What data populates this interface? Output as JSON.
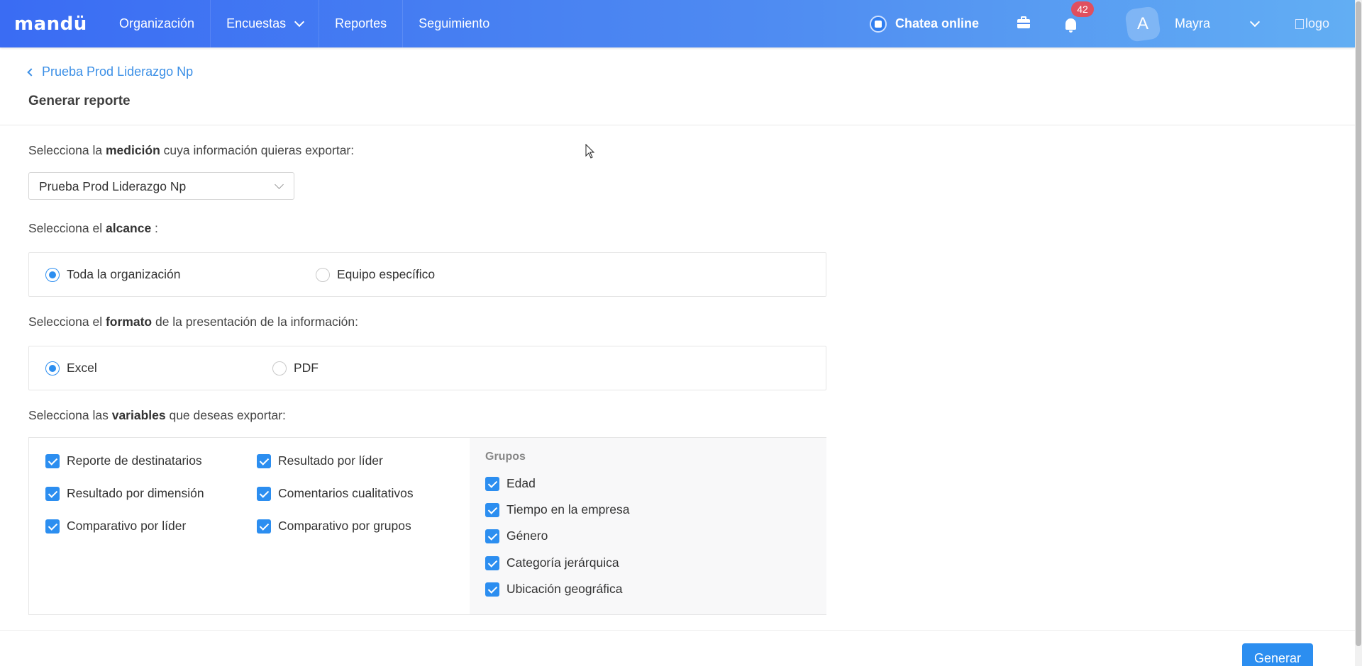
{
  "topbar": {
    "brand": "mandü",
    "nav": [
      "Organización",
      "Encuestas",
      "Reportes",
      "Seguimiento"
    ],
    "chat_label": "Chatea online",
    "notifications_count": "42",
    "avatar_initial": "A",
    "user_name": "Mayra",
    "logo_alt": "logo"
  },
  "header": {
    "back_label": "Prueba Prod Liderazgo Np",
    "title": "Generar reporte"
  },
  "form": {
    "measurement": {
      "label_pre": "Selecciona la ",
      "label_bold": "medición",
      "label_post": " cuya información quieras exportar:",
      "selected": "Prueba Prod Liderazgo Np"
    },
    "scope": {
      "label_pre": "Selecciona el ",
      "label_bold": "alcance",
      "label_post": " :",
      "options": [
        "Toda la organización",
        "Equipo específico"
      ],
      "selected": "Toda la organización"
    },
    "format": {
      "label_pre": "Selecciona el ",
      "label_bold": "formato",
      "label_post": " de la presentación de la información:",
      "options": [
        "Excel",
        "PDF"
      ],
      "selected": "Excel"
    },
    "variables": {
      "label_pre": "Selecciona las ",
      "label_bold": "variables",
      "label_post": " que deseas exportar:",
      "items": [
        "Reporte de destinatarios",
        "Resultado por líder",
        "Resultado por dimensión",
        "Comentarios cualitativos",
        "Comparativo por líder",
        "Comparativo por grupos"
      ],
      "groups_title": "Grupos",
      "groups": [
        "Edad",
        "Tiempo en la empresa",
        "Género",
        "Categoría jerárquica",
        "Ubicación geográfica"
      ]
    }
  },
  "footer": {
    "generate_label": "Generar"
  },
  "colors": {
    "primary": "#2c8ef0",
    "topbar_start": "#3a6cf3",
    "topbar_end": "#62aef3",
    "badge": "#e04f5f"
  }
}
